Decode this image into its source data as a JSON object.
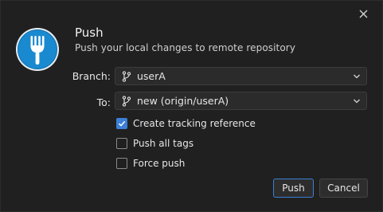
{
  "dialog": {
    "title": "Push",
    "subtitle": "Push your local changes to remote repository",
    "close_icon": "close-icon",
    "app_icon": "fork-icon",
    "accent_color": "#3b80d6"
  },
  "fields": {
    "branch_label": "Branch:",
    "branch_value": "userA",
    "to_label": "To:",
    "to_value": "new (origin/userA)"
  },
  "options": [
    {
      "label": "Create tracking reference",
      "checked": true
    },
    {
      "label": "Push all tags",
      "checked": false
    },
    {
      "label": "Force push",
      "checked": false
    }
  ],
  "buttons": {
    "push": "Push",
    "cancel": "Cancel"
  }
}
